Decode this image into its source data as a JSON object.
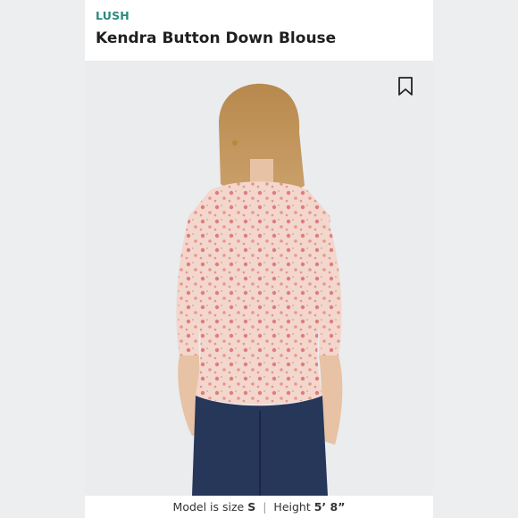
{
  "product": {
    "brand": "LUSH",
    "title": "Kendra Button Down Blouse"
  },
  "icons": {
    "bookmark": "bookmark-icon"
  },
  "model_info": {
    "size_label": "Model is size",
    "size_value": "S",
    "separator": "|",
    "height_label": "Height",
    "height_value": "5’ 8”"
  },
  "colors": {
    "brand": "#2a8a7c",
    "blouse": "#f2d3c9",
    "print": "#d9676a",
    "jeans": "#26375a"
  }
}
